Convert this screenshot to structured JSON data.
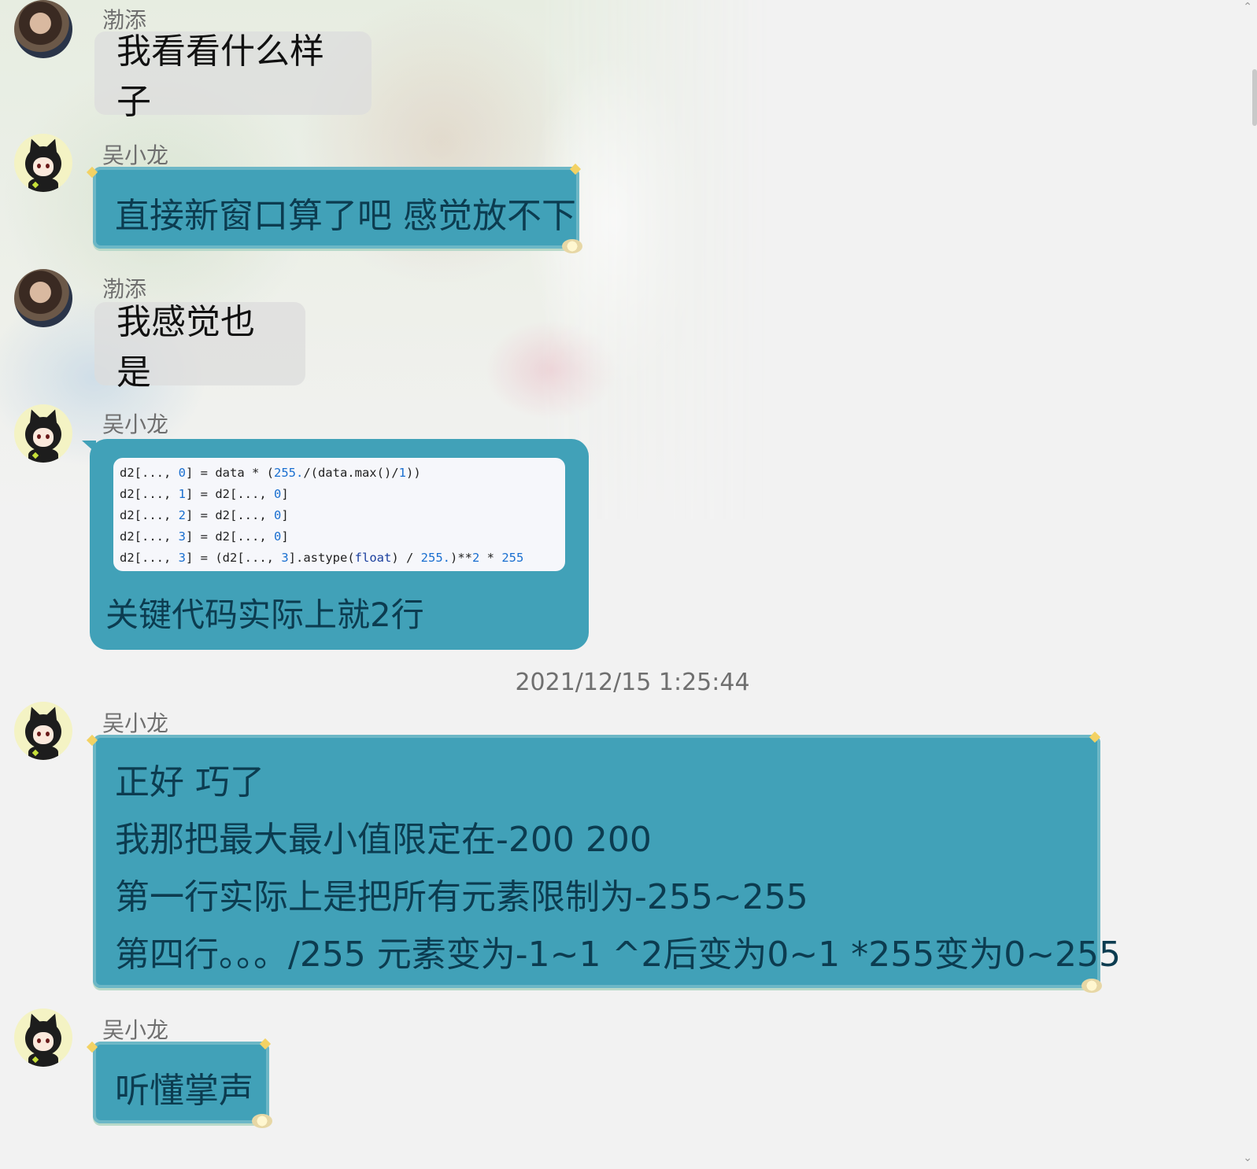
{
  "messages": [
    {
      "sender": "渤添",
      "text": "我看看什么样子"
    },
    {
      "sender": "吴小龙",
      "text": "直接新窗口算了吧 感觉放不下"
    },
    {
      "sender": "渤添",
      "text": "我感觉也是"
    },
    {
      "sender": "吴小龙",
      "code": [
        {
          "a": "d2[..., ",
          "n1": "0",
          "b": "] = data * (",
          "n2": "255.",
          "c": "/(data.max()/",
          "n3": "1",
          "d": "))"
        },
        {
          "a": "d2[..., ",
          "n1": "1",
          "b": "] = d2[..., ",
          "n2": "0",
          "c": "]",
          "n3": "",
          "d": ""
        },
        {
          "a": "d2[..., ",
          "n1": "2",
          "b": "] = d2[..., ",
          "n2": "0",
          "c": "]",
          "n3": "",
          "d": ""
        },
        {
          "a": "d2[..., ",
          "n1": "3",
          "b": "] = d2[..., ",
          "n2": "0",
          "c": "]",
          "n3": "",
          "d": ""
        },
        {
          "a": "d2[..., ",
          "n1": "3",
          "b": "] = (d2[..., ",
          "n2": "3",
          "c": "].astype(",
          "kw": "float",
          "e": ") / ",
          "n3": "255.",
          "d": ")**",
          "n4": "2",
          "f": " * ",
          "n5": "255"
        }
      ],
      "caption": "关键代码实际上就2行"
    },
    {
      "timestamp": "2021/12/15 1:25:44"
    },
    {
      "sender": "吴小龙",
      "lines": [
        "正好 巧了",
        "我那把最大最小值限定在-200 200",
        "第一行实际上是把所有元素限制为-255~255",
        "第四行。。。/255 元素变为-1~1 ^2后变为0~1 *255变为0~255"
      ]
    },
    {
      "sender": "吴小龙",
      "text": "听懂掌声"
    }
  ],
  "scrollbar": {
    "up_icon": "chevron-up-icon",
    "down_icon": "chevron-down-icon"
  },
  "colors": {
    "teal_bubble": "#41a1b8",
    "teal_text": "#0c3c50",
    "gray_bubble": "#dcdcdc",
    "page_bg": "#f2f2f2"
  }
}
